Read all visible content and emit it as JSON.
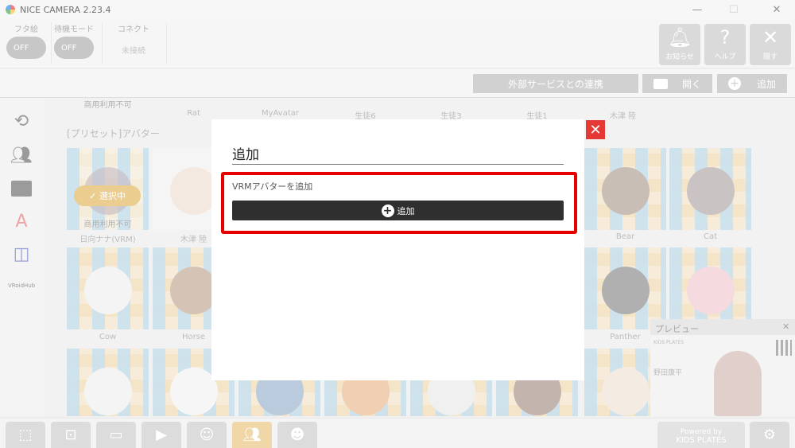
{
  "titlebar": {
    "title": "NICE CAMERA 2.23.4",
    "minimize": "—",
    "maximize": "☐",
    "close": "✕"
  },
  "toolbar": {
    "futa_label": "フタ絵",
    "futa_value": "OFF",
    "standby_label": "待機モード",
    "standby_value": "OFF",
    "connect_label": "コネクト",
    "connect_value": "未接続",
    "notify_label": "お知らせ",
    "help_label": "ヘルプ",
    "hide_label": "隠す"
  },
  "subbar": {
    "external": "外部サービスとの連携",
    "open": "開く",
    "add": "追加"
  },
  "sidebar": {
    "vroidhub": "VRoidHub"
  },
  "content": {
    "section_title": "[プリセット]アバター",
    "top_row_labels": [
      "Rat",
      "MyAvatar",
      "生徒6",
      "生徒3",
      "生徒1",
      "木津 陸"
    ],
    "top_badge": "商用利用不可",
    "row1_labels": [
      "日向ナナ(VRM)",
      "木津 陸",
      "Bear",
      "Cat"
    ],
    "row2_labels": [
      "Cow",
      "Horse",
      "Panther"
    ],
    "selected_badge": "✓ 選択中",
    "commercial_badge": "商用利用不可"
  },
  "preview": {
    "title": "プレビュー",
    "close": "✕",
    "brand": "KIDS PLATES",
    "name": "野田康平"
  },
  "bottom": {
    "powered": "Powered by",
    "brand": "KIDS PLATES"
  },
  "modal": {
    "title": "追加",
    "close": "✕",
    "section_label": "VRMアバターを追加",
    "button_label": "追加",
    "highlight_color": "#e60000"
  }
}
